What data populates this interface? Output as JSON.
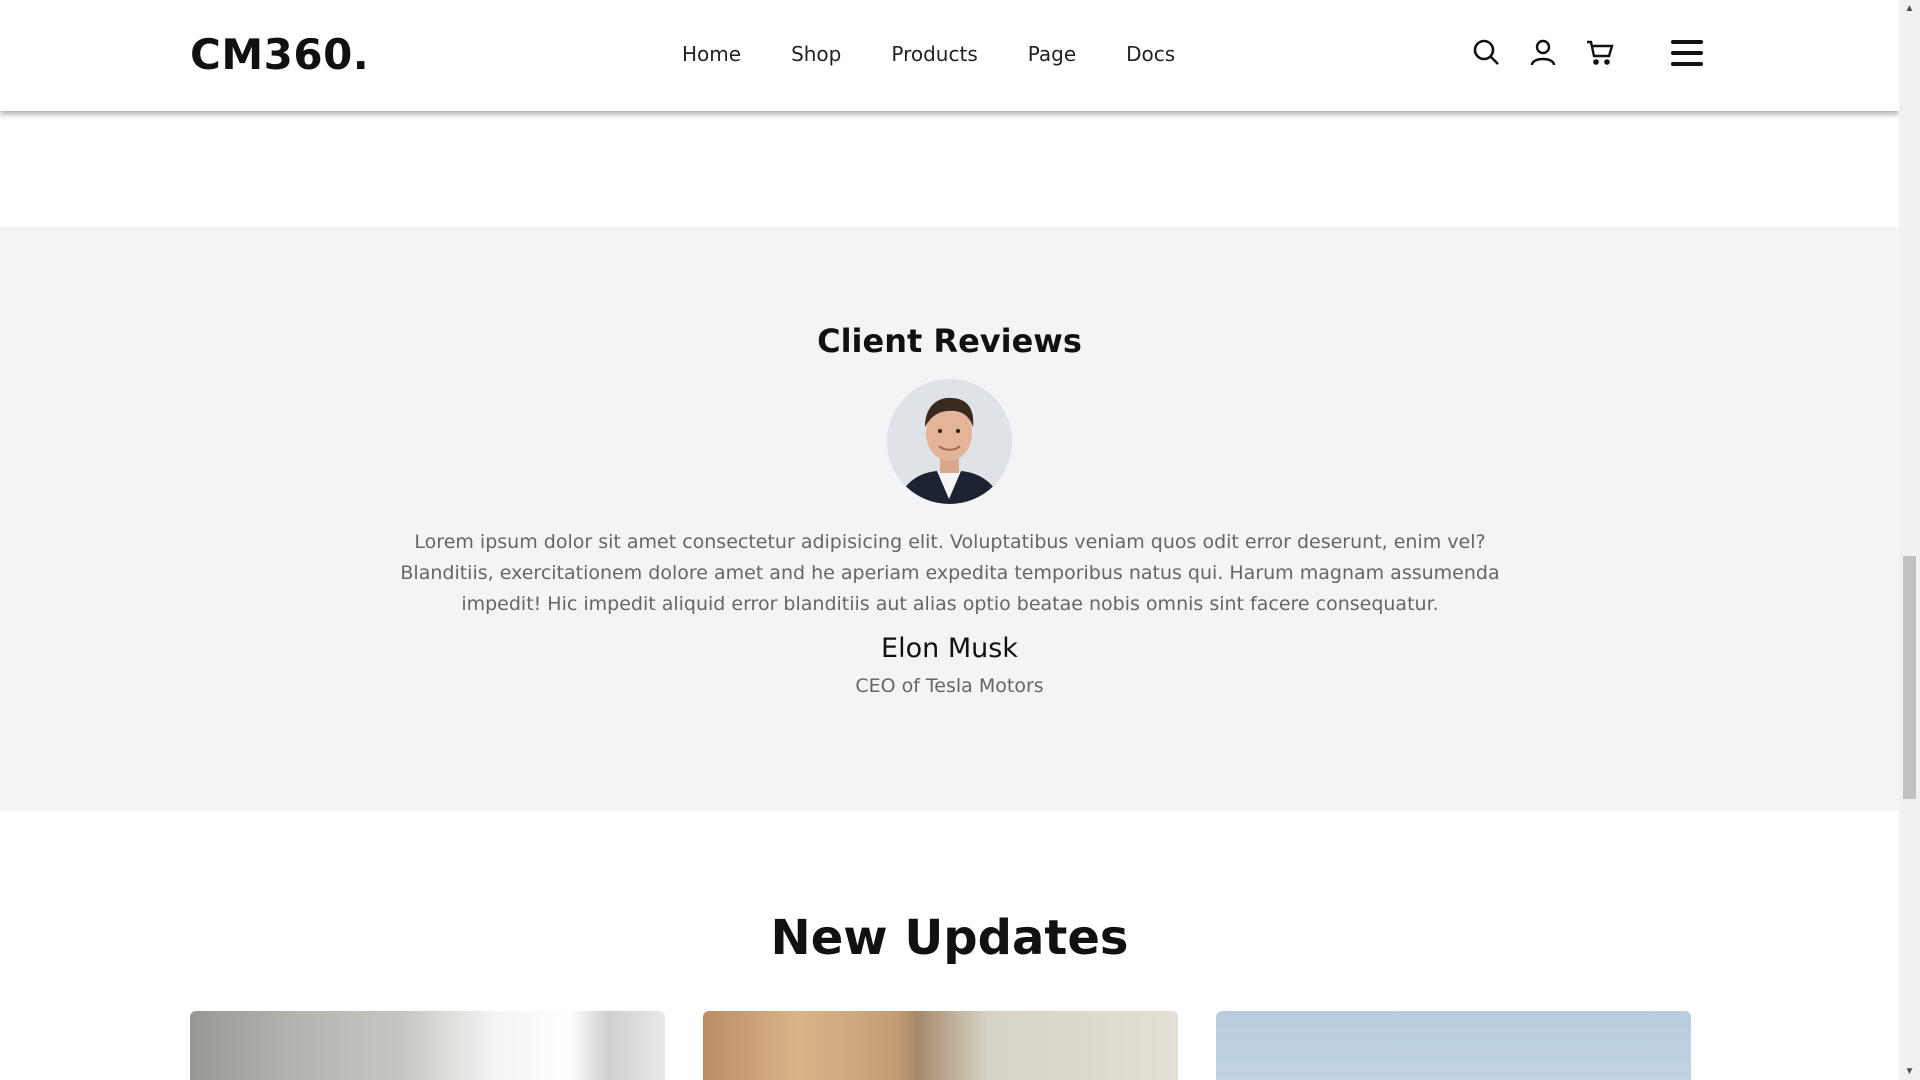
{
  "header": {
    "logo": "CM360.",
    "nav": [
      "Home",
      "Shop",
      "Products",
      "Page",
      "Docs"
    ],
    "icons": [
      "search-icon",
      "user-icon",
      "cart-icon",
      "menu-icon"
    ]
  },
  "reviews": {
    "title": "Client Reviews",
    "text": "Lorem ipsum dolor sit amet consectetur adipisicing elit. Voluptatibus veniam quos odit error deserunt, enim vel? Blanditiis, exercitationem dolore amet and he aperiam expedita temporibus natus qui. Harum magnam assumenda impedit! Hic impedit aliquid error blanditiis aut alias optio beatae nobis omnis sint facere consequatur.",
    "name": "Elon Musk",
    "role": "CEO of Tesla Motors"
  },
  "updates": {
    "title": "New Updates"
  },
  "colors": {
    "page_bg": "#ffffff",
    "reviews_bg": "#f3f4f6",
    "text_primary": "#111111",
    "text_muted": "#666666"
  }
}
